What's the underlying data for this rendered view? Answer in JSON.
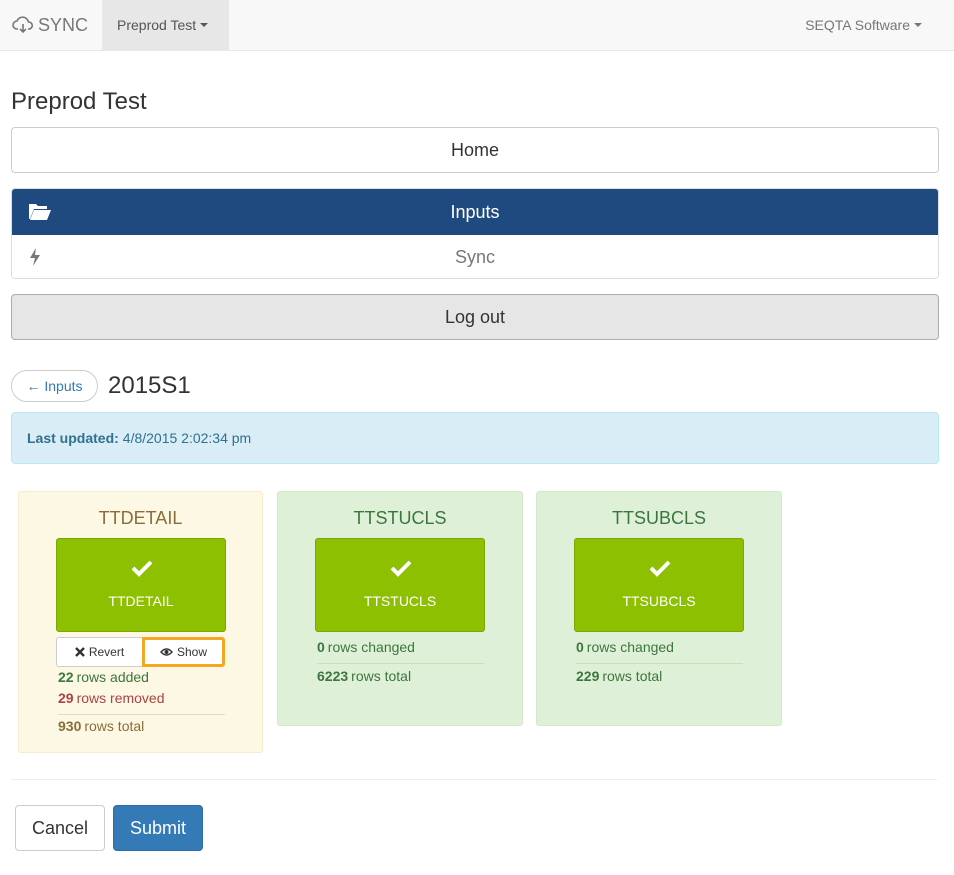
{
  "navbar": {
    "brand": "SYNC",
    "brand_icon": "cloud-sync-icon",
    "project_menu": "Preprod Test",
    "account_menu": "SEQTA Software"
  },
  "page": {
    "title": "Preprod Test"
  },
  "menu": {
    "home": "Home",
    "items": [
      {
        "label": "Inputs",
        "icon": "folder-open-icon",
        "active": true
      },
      {
        "label": "Sync",
        "icon": "lightning-icon",
        "active": false
      }
    ],
    "logout": "Log out"
  },
  "detail": {
    "back_label": "← Inputs",
    "heading": "2015S1",
    "alert_label": "Last updated:",
    "alert_value": "4/8/2015 2:02:34 pm"
  },
  "panels": [
    {
      "title": "TTDETAIL",
      "state": "warning",
      "tile_label": "TTDETAIL",
      "revert_label": "Revert",
      "show_label": "Show",
      "added_num": "22",
      "added_text": "rows added",
      "removed_num": "29",
      "removed_text": "rows removed",
      "total_num": "930",
      "total_text": "rows total"
    },
    {
      "title": "TTSTUCLS",
      "state": "success",
      "tile_label": "TTSTUCLS",
      "changed_num": "0",
      "changed_text": "rows changed",
      "total_num": "6223",
      "total_text": "rows total"
    },
    {
      "title": "TTSUBCLS",
      "state": "success",
      "tile_label": "TTSUBCLS",
      "changed_num": "0",
      "changed_text": "rows changed",
      "total_num": "229",
      "total_text": "rows total"
    }
  ],
  "actions": {
    "cancel": "Cancel",
    "submit": "Submit"
  },
  "colors": {
    "primary": "#337ab7",
    "nav_active": "#1f4a7f",
    "tile_green": "#8dc000",
    "highlight": "#f5a623"
  }
}
